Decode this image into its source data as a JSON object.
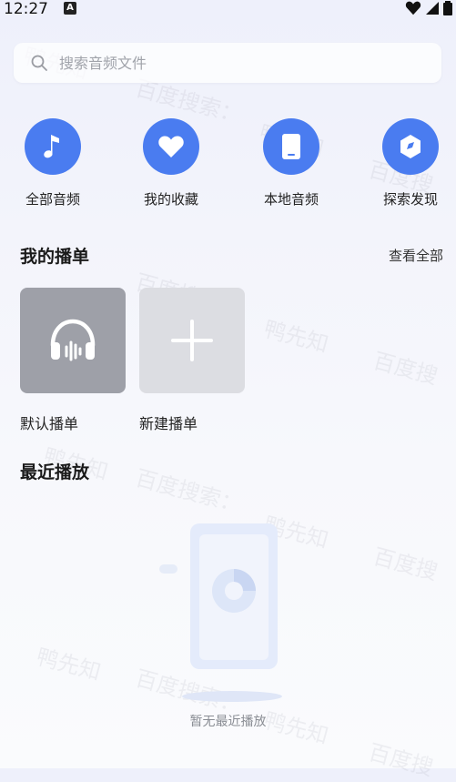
{
  "status_bar": {
    "time": "12:27",
    "notification_badge": "A"
  },
  "search": {
    "placeholder": "搜索音频文件",
    "value": ""
  },
  "quick_actions": [
    {
      "label": "全部音频",
      "icon": "music-note-icon"
    },
    {
      "label": "我的收藏",
      "icon": "heart-icon"
    },
    {
      "label": "本地音频",
      "icon": "phone-icon"
    },
    {
      "label": "探索发现",
      "icon": "compass-icon"
    }
  ],
  "my_playlists": {
    "title": "我的播单",
    "see_all": "查看全部",
    "items": [
      {
        "label": "默认播单",
        "icon": "headphones-icon"
      },
      {
        "label": "新建播单",
        "icon": "plus-icon"
      }
    ]
  },
  "recent": {
    "title": "最近播放",
    "empty_text": "暂无最近播放"
  },
  "watermark": {
    "text_a": "百度搜索：",
    "text_b": "鸭先知",
    "text_c": "百度搜索：鸭先知",
    "text_d": "百度搜"
  },
  "colors": {
    "accent": "#4a7cf0",
    "default_playlist_bg": "#9ea0a8",
    "new_playlist_bg": "#dcdde2"
  }
}
